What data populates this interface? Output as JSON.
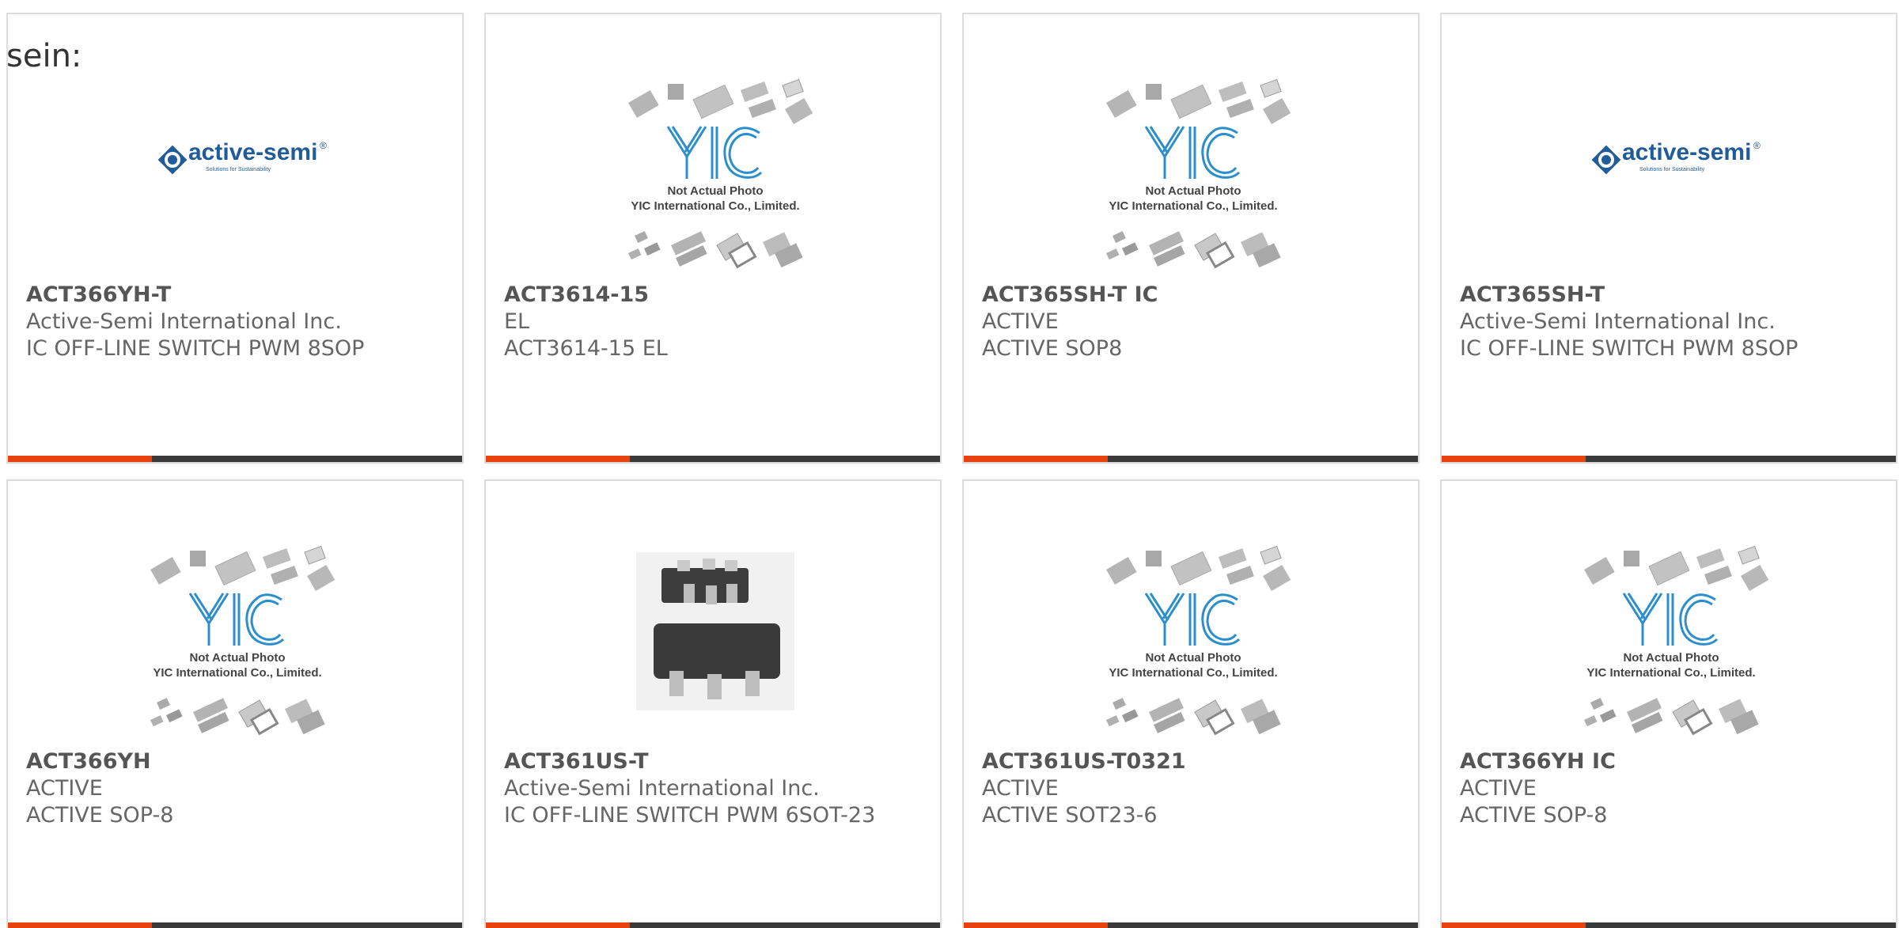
{
  "intro_text": "sein:",
  "colors": {
    "accent": "#e8420f",
    "bar": "#3a3a3a",
    "border": "#dddddd",
    "text": "#666666",
    "yic_blue": "#2b8fcb",
    "active_semi_blue": "#1f5c99"
  },
  "cards": [
    {
      "part": "ACT366YH-T",
      "maker": "Active-Semi International Inc.",
      "desc": "IC OFF-LINE SWITCH PWM 8SOP",
      "image": "active-semi-logo"
    },
    {
      "part": "ACT3614-15",
      "maker": "EL",
      "desc": "ACT3614-15 EL",
      "image": "yic-not-actual-photo"
    },
    {
      "part": "ACT365SH-T IC",
      "maker": "ACTIVE",
      "desc": "ACTIVE SOP8",
      "image": "yic-not-actual-photo"
    },
    {
      "part": "ACT365SH-T",
      "maker": "Active-Semi International Inc.",
      "desc": "IC OFF-LINE SWITCH PWM 8SOP",
      "image": "active-semi-logo"
    },
    {
      "part": "ACT366YH",
      "maker": "ACTIVE",
      "desc": "ACTIVE SOP-8",
      "image": "yic-not-actual-photo"
    },
    {
      "part": "ACT361US-T",
      "maker": "Active-Semi International Inc.",
      "desc": "IC OFF-LINE SWITCH PWM 6SOT-23",
      "image": "sot23-6-chip-photo"
    },
    {
      "part": "ACT361US-T0321",
      "maker": "ACTIVE",
      "desc": "ACTIVE SOT23-6",
      "image": "yic-not-actual-photo"
    },
    {
      "part": "ACT366YH IC",
      "maker": "ACTIVE",
      "desc": "ACTIVE SOP-8",
      "image": "yic-not-actual-photo"
    }
  ],
  "placeholder_image": {
    "caption_line1": "Not Actual Photo",
    "caption_line2": "YIC International Co., Limited.",
    "logo_text": "YIC"
  },
  "active_semi_logo": {
    "brand": "active-semi",
    "registered_mark": "®",
    "tagline": "Solutions for Sustainability"
  }
}
